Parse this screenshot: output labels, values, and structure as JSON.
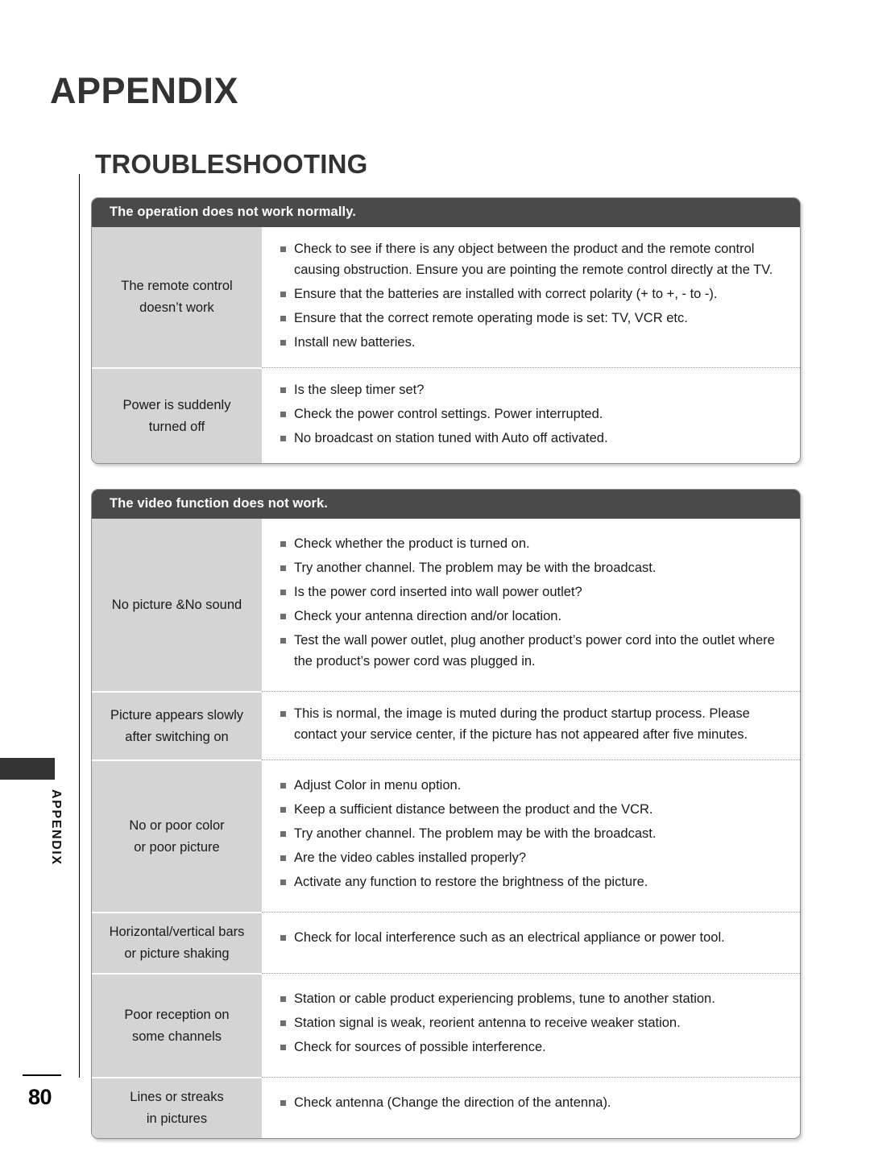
{
  "page": {
    "chapter_title": "APPENDIX",
    "section_title": "TROUBLESHOOTING",
    "side_tab_label": "APPENDIX",
    "page_number": "80",
    "colors": {
      "header_bar": "#4a4a4a",
      "symptom_cell": "#d4d4d4",
      "heading_text": "#333333",
      "bullet": "#6e6e6e"
    }
  },
  "tables": [
    {
      "header": "The operation does not work normally.",
      "rows": [
        {
          "symptom_lines": [
            "The remote control",
            "doesn’t work"
          ],
          "remedies": [
            "Check to see if there is any object between the product and the remote control causing obstruction. Ensure you are pointing the remote control directly at the TV.",
            "Ensure that the batteries are installed with correct polarity (+ to +, - to -).",
            "Ensure that the correct remote operating mode is set: TV, VCR etc.",
            "Install new batteries."
          ]
        },
        {
          "symptom_lines": [
            "Power is suddenly",
            "turned off"
          ],
          "remedies": [
            "Is the sleep timer set?",
            "Check the power control settings. Power interrupted.",
            "No broadcast on station tuned with Auto off activated."
          ]
        }
      ]
    },
    {
      "header": "The video function does not work.",
      "rows": [
        {
          "symptom_lines": [
            "No picture &No sound"
          ],
          "remedies": [
            "Check whether the product is turned on.",
            "Try another channel. The problem may be with the broadcast.",
            "Is the power cord inserted into wall power outlet?",
            "Check your antenna direction and/or location.",
            "Test the wall power outlet, plug another product’s power cord into the outlet where the product’s power cord was plugged in."
          ]
        },
        {
          "symptom_lines": [
            "Picture appears slowly",
            "after switching on"
          ],
          "remedies": [
            "This is normal, the image is muted during the product startup process. Please contact your service center, if the picture has not appeared after five minutes."
          ]
        },
        {
          "symptom_lines": [
            "No or poor color",
            "or poor picture"
          ],
          "remedies": [
            "Adjust Color in menu option.",
            "Keep a sufficient distance between the product and the VCR.",
            "Try another channel. The problem may be with the broadcast.",
            "Are the video cables installed properly?",
            "Activate any function to restore the brightness of the picture."
          ]
        },
        {
          "symptom_lines": [
            "Horizontal/vertical bars",
            "or picture shaking"
          ],
          "remedies": [
            "Check for local interference such as an electrical appliance or power tool."
          ]
        },
        {
          "symptom_lines": [
            "Poor reception on",
            "some channels"
          ],
          "remedies": [
            "Station or cable product experiencing problems, tune to another station.",
            "Station signal is weak, reorient antenna to receive weaker station.",
            "Check for sources of possible interference."
          ]
        },
        {
          "symptom_lines": [
            "Lines or streaks",
            "in pictures"
          ],
          "remedies": [
            "Check antenna (Change the direction of the antenna)."
          ]
        }
      ]
    }
  ]
}
